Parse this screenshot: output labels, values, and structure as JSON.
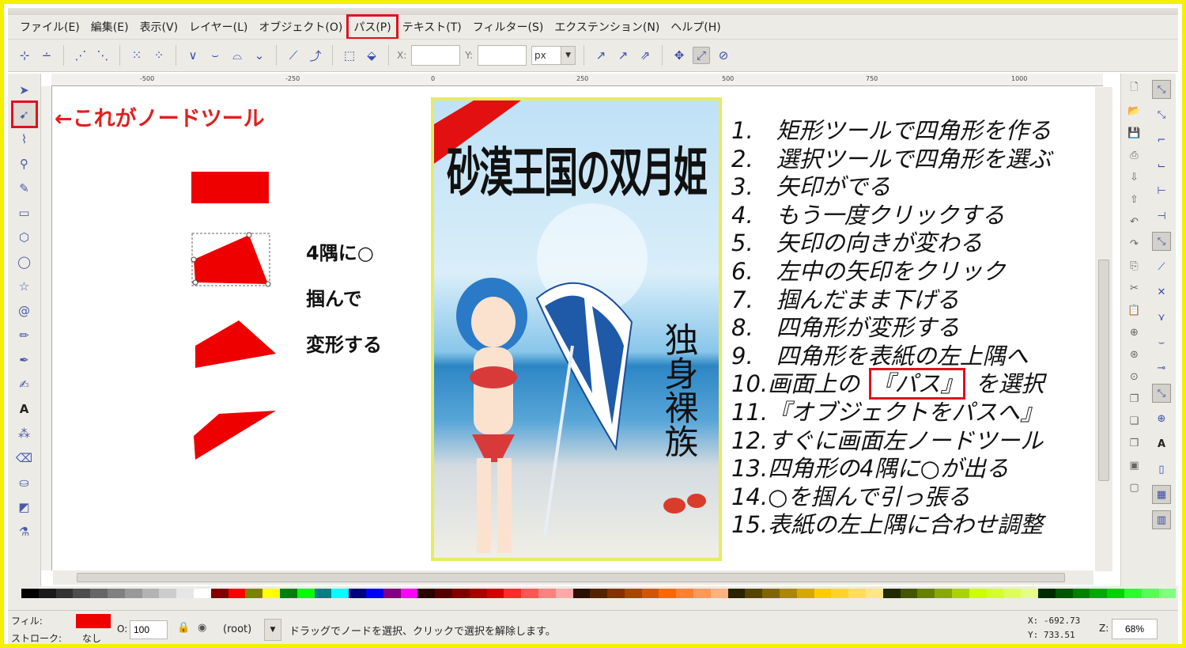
{
  "menubar": {
    "items": [
      "ファイル(E)",
      "編集(E)",
      "表示(V)",
      "レイヤー(L)",
      "オブジェクト(O)",
      "パス(P)",
      "テキスト(T)",
      "フィルター(S)",
      "エクステンション(N)",
      "ヘルプ(H)"
    ],
    "highlighted_index": 5
  },
  "toolbar": {
    "x_label": "X:",
    "y_label": "Y:",
    "x_value": "",
    "y_value": "",
    "unit": "px"
  },
  "rulers": {
    "h_ticks": [
      "-500",
      "-250",
      "0",
      "250",
      "500",
      "750",
      "1000"
    ]
  },
  "canvas": {
    "node_tool_annotation": "←これがノードツール",
    "corner_label_1": "4隅に○",
    "corner_label_2": "掴んで",
    "corner_label_3": "変形する",
    "cover": {
      "title": "砂漠王国の双月姫",
      "vertical_text": "独身裸族"
    },
    "steps": [
      "1.　矩形ツールで四角形を作る",
      "2.　選択ツールで四角形を選ぶ",
      "3.　矢印がでる",
      "4.　もう一度クリックする",
      "5.　矢印の向きが変わる",
      "6.　左中の矢印をクリック",
      "7.　掴んだまま下げる",
      "8.　四角形が変形する",
      "9.　四角形を表紙の左上隅へ",
      "10.画面上の",
      "11.『オブジェクトをパスへ』",
      "12.すぐに画面左ノードツール",
      "13.四角形の4隅に○が出る",
      "14.○を掴んで引っ張る",
      "15.表紙の左上隅に合わせ調整"
    ],
    "step10_highlight": "『パス』",
    "step10_suffix": "を選択"
  },
  "statusbar": {
    "fill_label": "フィル:",
    "stroke_label": "ストローク:",
    "stroke_value": "なし",
    "fill_color": "#ee0000",
    "opacity_label": "O:",
    "opacity_value": "100",
    "layer": "(root)",
    "message": "ドラッグでノードを選択、クリックで選択を解除します。",
    "x_coord": "X: -692.73",
    "y_coord": "Y: 733.51",
    "zoom_label": "Z:",
    "zoom_value": "68%"
  },
  "colors": {
    "accent_red": "#e01020",
    "frame_yellow": "#f4f000",
    "shape_red": "#ee0000"
  }
}
